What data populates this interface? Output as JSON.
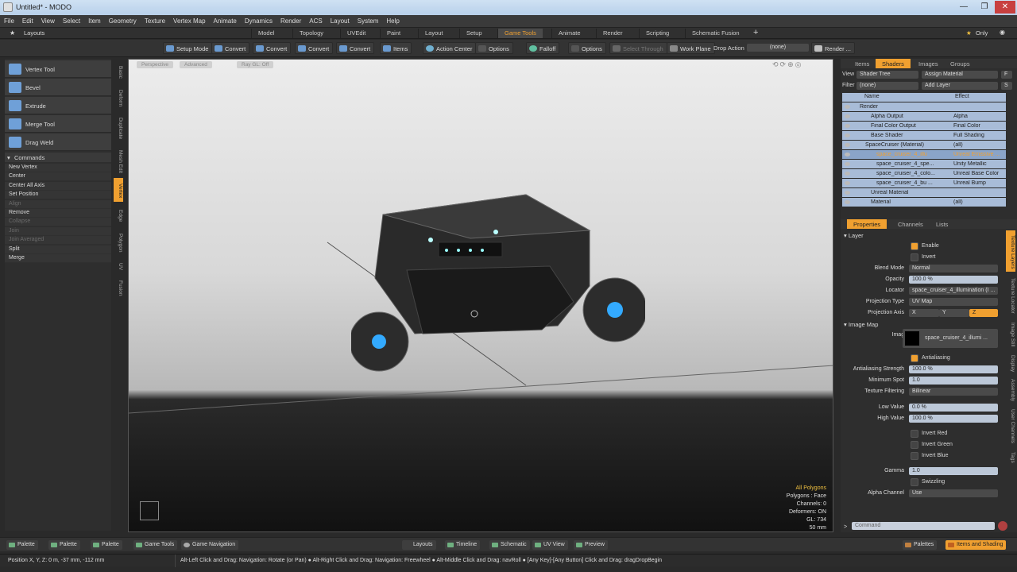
{
  "window": {
    "title": "Untitled* - MODO",
    "min": "—",
    "max": "❐",
    "close": "✕"
  },
  "menu": [
    "File",
    "Edit",
    "View",
    "Select",
    "Item",
    "Geometry",
    "Texture",
    "Vertex Map",
    "Animate",
    "Dynamics",
    "Render",
    "ACS",
    "Layout",
    "System",
    "Help"
  ],
  "layouts": {
    "label": "Layouts",
    "tabs": [
      "Model",
      "Topology",
      "UVEdit",
      "Paint",
      "Layout",
      "Setup",
      "Game Tools",
      "Animate",
      "Render",
      "Scripting",
      "Schematic Fusion"
    ],
    "active": "Game Tools",
    "add": "+",
    "only": "Only"
  },
  "toolbar": [
    "Setup Mode",
    "Convert",
    "Convert",
    "Convert",
    "Convert",
    "Items",
    "Action Center",
    "Options",
    "Falloff",
    "Options",
    "Select Through",
    "Work Plane",
    "Drop Action",
    "(none)",
    "Render ..."
  ],
  "tools": [
    "Vertex Tool",
    "Bevel",
    "Extrude",
    "Merge Tool",
    "Drag Weld"
  ],
  "commands": {
    "header": "Commands",
    "items": [
      {
        "label": "New Vertex",
        "on": true
      },
      {
        "label": "Center",
        "on": true
      },
      {
        "label": "Center All Axis",
        "on": true
      },
      {
        "label": "Set Position",
        "on": true
      },
      {
        "label": "Align",
        "on": false
      },
      {
        "label": "Remove",
        "on": true
      },
      {
        "label": "Collapse",
        "on": false
      },
      {
        "label": "Join",
        "on": false
      },
      {
        "label": "Join Averaged",
        "on": false
      },
      {
        "label": "Split",
        "on": true
      },
      {
        "label": "Merge",
        "on": true
      }
    ]
  },
  "vtabs": [
    "Basic",
    "Deform",
    "Duplicate",
    "Mesh Edit",
    "Vertex",
    "Edge",
    "Polygon",
    "UV",
    "Fusion"
  ],
  "viewport": {
    "buttons": [
      "Perspective",
      "Advanced",
      "Ray GL: Off"
    ],
    "stats": [
      "All Polygons",
      "Polygons : Face",
      "Channels: 0",
      "Deformers: ON",
      "GL: 734",
      "50 mm"
    ]
  },
  "right": {
    "tabs": [
      "Items",
      "Shaders",
      "Images",
      "Groups"
    ],
    "activeTab": "Shaders",
    "view": {
      "label": "View",
      "value": "Shader Tree",
      "btn": "Assign Material",
      "f": "F"
    },
    "filter": {
      "label": "Filter",
      "value": "(none)",
      "btn": "Add Layer",
      "s": "S"
    },
    "cols": {
      "name": "Name",
      "effect": "Effect"
    },
    "rows": [
      {
        "name": "Render",
        "effect": "",
        "indent": 0
      },
      {
        "name": "Alpha Output",
        "effect": "Alpha",
        "indent": 2
      },
      {
        "name": "Final Color Output",
        "effect": "Final Color",
        "indent": 2
      },
      {
        "name": "Base Shader",
        "effect": "Full Shading",
        "indent": 2
      },
      {
        "name": "SpaceCruiser (Material)",
        "effect": "(all)",
        "indent": 1
      },
      {
        "name": "space_cruiser_4_illu",
        "effect": "Unreal Emissive ...",
        "indent": 3,
        "sel": true
      },
      {
        "name": "space_cruiser_4_spe...",
        "effect": "Unity Metallic",
        "indent": 3
      },
      {
        "name": "space_cruiser_4_colo...",
        "effect": "Unreal Base Color",
        "indent": 3
      },
      {
        "name": "space_cruiser_4_bu ...",
        "effect": "Unreal Bump",
        "indent": 3
      },
      {
        "name": "Unreal Material",
        "effect": "",
        "indent": 2
      },
      {
        "name": "Material",
        "effect": "(all)",
        "indent": 2
      }
    ],
    "ptabs": [
      "Properties",
      "Channels",
      "Lists"
    ],
    "pActive": "Properties",
    "layer": "Layer",
    "enable": "Enable",
    "invert": "Invert",
    "props": [
      {
        "label": "Blend Mode",
        "value": "Normal",
        "kind": "drop"
      },
      {
        "label": "Opacity",
        "value": "100.0 %",
        "kind": "field"
      },
      {
        "label": "Locator",
        "value": "space_cruiser_4_illumination (I ...",
        "kind": "drop"
      },
      {
        "label": "Projection Type",
        "value": "UV Map",
        "kind": "drop"
      }
    ],
    "projAxis": {
      "label": "Projection Axis",
      "x": "X",
      "y": "Y",
      "z": "Z"
    },
    "imageMap": "Image Map",
    "image": {
      "label": "Image",
      "value": "space_cruiser_4_illumi ..."
    },
    "antialiasing": "Antialiasing",
    "props2": [
      {
        "label": "Antialiasing Strength",
        "value": "100.0 %",
        "kind": "field"
      },
      {
        "label": "Minimum Spot",
        "value": "1.0",
        "kind": "field"
      },
      {
        "label": "Texture Filtering",
        "value": "Bilinear",
        "kind": "drop"
      },
      {
        "label": "Low Value",
        "value": "0.0 %",
        "kind": "field"
      },
      {
        "label": "High Value",
        "value": "100.0 %",
        "kind": "field"
      }
    ],
    "checks": [
      "Invert Red",
      "Invert Green",
      "Invert Blue"
    ],
    "gamma": {
      "label": "Gamma",
      "value": "1.0"
    },
    "swizzling": "Swizzling",
    "alpha": {
      "label": "Alpha Channel",
      "value": "Use"
    },
    "sideTabs": [
      "Texture Layers",
      "Texture Locator",
      "Image Still",
      "Display",
      "Assembly",
      "User Channels",
      "Tags"
    ],
    "command": "Command"
  },
  "bottom": {
    "left": [
      "Palette",
      "Palette",
      "Palette",
      "Game Tools",
      "Game Navigation"
    ],
    "mid": [
      "Layouts",
      "Timeline",
      "Schematic",
      "UV View",
      "Preview"
    ],
    "right": [
      "Palettes",
      "Items and Shading"
    ]
  },
  "status": {
    "pos": "Position X, Y, Z:  0 m, -37 mm, -112 mm",
    "hint": "Alt-Left Click and Drag: Navigation: Rotate (or Pan) ● Alt-Right Click and Drag: Navigation: Freewheel ● Alt-Middle Click and Drag: navRoll ● [Any Key]-[Any Button] Click and Drag: dragDropBegin"
  }
}
